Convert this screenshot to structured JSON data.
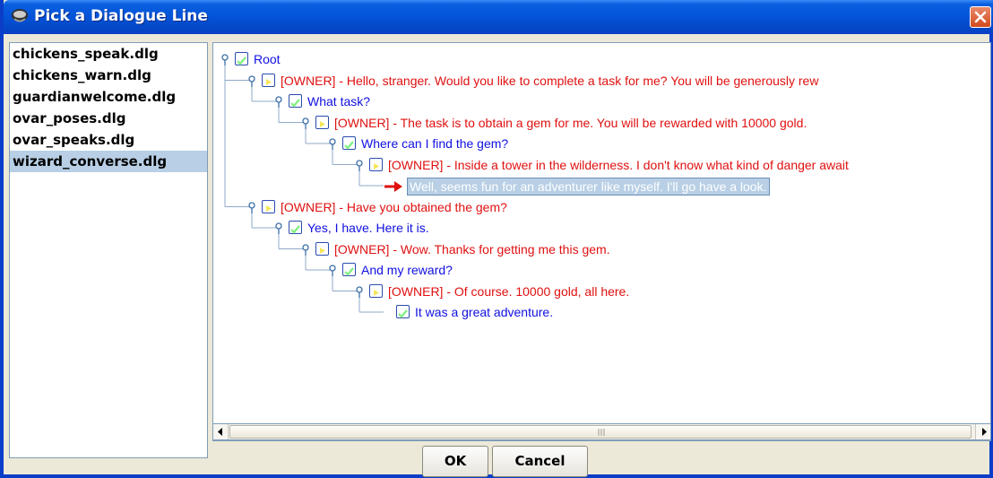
{
  "window": {
    "title": "Pick a Dialogue Line"
  },
  "files": [
    {
      "name": "chickens_speak.dlg",
      "selected": false
    },
    {
      "name": "chickens_warn.dlg",
      "selected": false
    },
    {
      "name": "guardianwelcome.dlg",
      "selected": false
    },
    {
      "name": "ovar_poses.dlg",
      "selected": false
    },
    {
      "name": "ovar_speaks.dlg",
      "selected": false
    },
    {
      "name": "wizard_converse.dlg",
      "selected": true
    }
  ],
  "tree": {
    "root_label": "Root",
    "nodes": [
      {
        "text": "[OWNER] - Hello, stranger.  Would you like to complete a task for me?  You will be generously rew",
        "speaker": "owner"
      },
      {
        "text": "What task?",
        "speaker": "player"
      },
      {
        "text": "[OWNER] - The task is to obtain a gem for me.  You will be rewarded with 10000 gold.",
        "speaker": "owner"
      },
      {
        "text": "Where can I find the gem?",
        "speaker": "player"
      },
      {
        "text": "[OWNER] - Inside a tower in the wilderness.  I don't know what kind of danger await",
        "speaker": "owner"
      },
      {
        "text": "Well, seems fun for an adventurer like myself.  I'll go have a look.",
        "speaker": "player",
        "selected": true
      },
      {
        "text": "[OWNER] - Have you obtained the gem?",
        "speaker": "owner"
      },
      {
        "text": "Yes, I have.  Here it is.",
        "speaker": "player"
      },
      {
        "text": "[OWNER] - Wow.  Thanks for getting me this gem.",
        "speaker": "owner"
      },
      {
        "text": "And my reward?",
        "speaker": "player"
      },
      {
        "text": "[OWNER] - Of course. 10000 gold, all here.",
        "speaker": "owner"
      },
      {
        "text": "It was a great adventure.",
        "speaker": "player"
      }
    ]
  },
  "buttons": {
    "ok": "OK",
    "cancel": "Cancel"
  },
  "colors": {
    "owner_text": "#e01010",
    "player_text": "#1010e0",
    "selection": "#b8cfe5",
    "titlebar": "#0453d8"
  }
}
